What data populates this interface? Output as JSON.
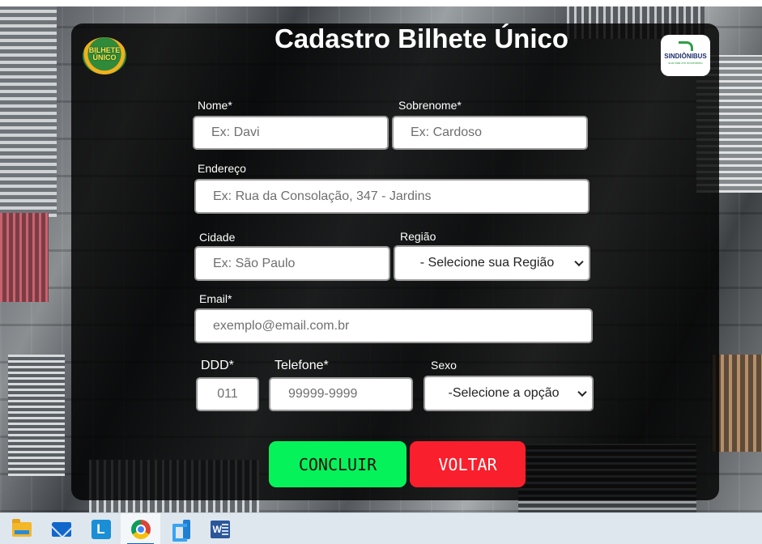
{
  "form": {
    "title": "Cadastro Bilhete Único",
    "logo_left_text": "BILHETE ÚNICO",
    "logo_right_text": "SINDIÔNIBUS",
    "logo_right_sub": "sua vida em movimento",
    "fields": {
      "nome": {
        "label": "Nome*",
        "placeholder": "Ex: Davi"
      },
      "sobrenome": {
        "label": "Sobrenome*",
        "placeholder": "Ex: Cardoso"
      },
      "endereco": {
        "label": "Endereço",
        "placeholder": "Ex: Rua da Consolação, 347 - Jardins"
      },
      "cidade": {
        "label": "Cidade",
        "placeholder": "Ex: São Paulo"
      },
      "regiao": {
        "label": "Região",
        "selected": "- Selecione sua Região"
      },
      "email": {
        "label": "Email*",
        "placeholder": "exemplo@email.com.br"
      },
      "ddd": {
        "label": "DDD*",
        "placeholder": "011"
      },
      "telefone": {
        "label": "Telefone*",
        "placeholder": "99999-9999"
      },
      "sexo": {
        "label": "Sexo",
        "selected": "-Selecione a opção"
      }
    },
    "buttons": {
      "concluir": "CONCLUIR",
      "voltar": "VOLTAR"
    }
  },
  "colors": {
    "concluir_bg": "#06f25a",
    "voltar_bg": "#fa1f2c",
    "panel_bg": "rgba(0,0,0,0.82)"
  },
  "taskbar": {
    "apps": [
      "file-explorer-icon",
      "mail-icon",
      "launcher-l-icon",
      "chrome-icon",
      "vscode-icon",
      "word-icon"
    ],
    "active": "chrome-icon"
  }
}
